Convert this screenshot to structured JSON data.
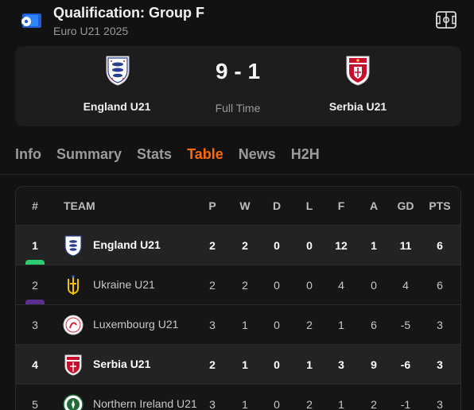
{
  "header": {
    "title": "Qualification: Group F",
    "subtitle": "Euro U21 2025"
  },
  "match": {
    "home": {
      "name": "England U21"
    },
    "away": {
      "name": "Serbia U21"
    },
    "score": "9 - 1",
    "status": "Full Time"
  },
  "tabs": [
    {
      "label": "Info",
      "active": false
    },
    {
      "label": "Summary",
      "active": false
    },
    {
      "label": "Stats",
      "active": false
    },
    {
      "label": "Table",
      "active": true
    },
    {
      "label": "News",
      "active": false
    },
    {
      "label": "H2H",
      "active": false
    }
  ],
  "table": {
    "headers": {
      "rank": "#",
      "team": "TEAM",
      "p": "P",
      "w": "W",
      "d": "D",
      "l": "L",
      "f": "F",
      "a": "A",
      "gd": "GD",
      "pts": "PTS"
    },
    "rows": [
      {
        "rank": "1",
        "team": "England U21",
        "crest": "england-crest-icon",
        "p": "2",
        "w": "2",
        "d": "0",
        "l": "0",
        "f": "12",
        "a": "1",
        "gd": "11",
        "pts": "6",
        "highlight": true,
        "marker": "#2ecc71"
      },
      {
        "rank": "2",
        "team": "Ukraine U21",
        "crest": "ukraine-crest-icon",
        "p": "2",
        "w": "2",
        "d": "0",
        "l": "0",
        "f": "4",
        "a": "0",
        "gd": "4",
        "pts": "6",
        "highlight": false,
        "marker": "#5b2d8e"
      },
      {
        "rank": "3",
        "team": "Luxembourg U21",
        "crest": "luxembourg-crest-icon",
        "p": "3",
        "w": "1",
        "d": "0",
        "l": "2",
        "f": "1",
        "a": "6",
        "gd": "-5",
        "pts": "3",
        "highlight": false,
        "marker": ""
      },
      {
        "rank": "4",
        "team": "Serbia U21",
        "crest": "serbia-crest-icon",
        "p": "2",
        "w": "1",
        "d": "0",
        "l": "1",
        "f": "3",
        "a": "9",
        "gd": "-6",
        "pts": "3",
        "highlight": true,
        "marker": ""
      },
      {
        "rank": "5",
        "team": "Northern Ireland U21",
        "crest": "northern-ireland-crest-icon",
        "p": "3",
        "w": "1",
        "d": "0",
        "l": "2",
        "f": "1",
        "a": "2",
        "gd": "-1",
        "pts": "3",
        "highlight": false,
        "marker": ""
      }
    ]
  },
  "colors": {
    "accent": "#ff6a00",
    "background": "#121212",
    "card": "#1d1d1d"
  }
}
